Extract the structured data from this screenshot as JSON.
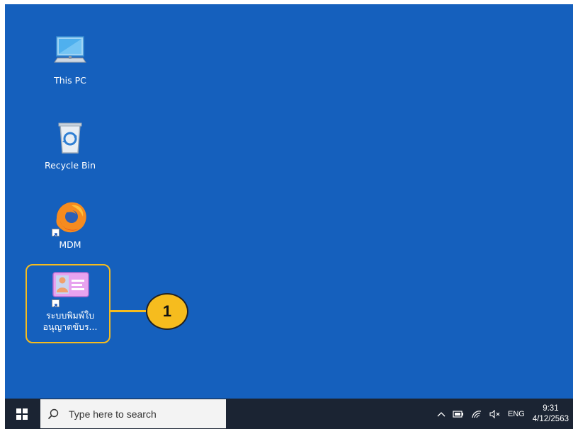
{
  "desktop": {
    "icons": [
      {
        "label": "This PC",
        "icon": "computer-icon"
      },
      {
        "label": "Recycle Bin",
        "icon": "recycle-bin-icon"
      },
      {
        "label": "MDM",
        "icon": "firefox-icon"
      },
      {
        "label_line1": "ระบบพิมพ์ใบ",
        "label_line2": "อนุญาตขับร...",
        "icon": "id-card-icon"
      }
    ],
    "callout": {
      "number": "1",
      "color": "#f6bc1e"
    }
  },
  "taskbar": {
    "search_placeholder": "Type here to search",
    "tray": {
      "language": "ENG",
      "time": "9:31",
      "date": "4/12/2563"
    }
  },
  "colors": {
    "desktop": "#1560bd",
    "taskbar": "#1b2433",
    "accent": "#f6bc1e"
  }
}
